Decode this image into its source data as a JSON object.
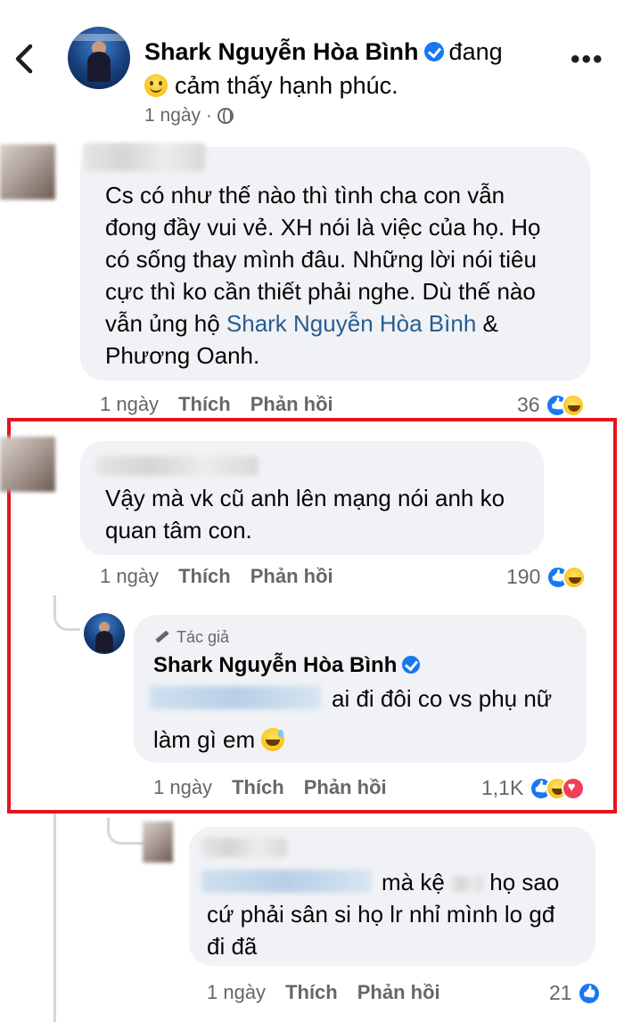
{
  "header": {
    "author_name": "Shark Nguyễn Hòa Bình",
    "status_word": "đang",
    "feeling": "cảm thấy hạnh phúc.",
    "post_time": "1 ngày ·",
    "more_label": "•••"
  },
  "comments": [
    {
      "text_lines": [
        "Cs có như thế nào thì tình cha con vẫn",
        "đong đầy vui vẻ. XH nói là việc của họ. Họ",
        "có sống thay mình đâu. Những lời nói tiêu",
        "cực thì ko cần thiết phải nghe. Dù thế nào"
      ],
      "line5_prefix": "vẫn ủng hộ ",
      "mention": "Shark Nguyễn Hòa Bình",
      "line5_suffix": "  &",
      "line6": "Phương Oanh.",
      "time": "1 ngày",
      "like_label": "Thích",
      "reply_label": "Phản hồi",
      "reaction_count": "36"
    },
    {
      "text_lines": [
        "Vậy mà vk cũ anh lên mạng nói anh ko",
        "quan tâm con."
      ],
      "time": "1 ngày",
      "like_label": "Thích",
      "reply_label": "Phản hồi",
      "reaction_count": "190"
    }
  ],
  "author_reply": {
    "badge": "Tác giả",
    "name": "Shark Nguyễn Hòa Bình",
    "line1": "ai đi đôi co vs phụ nữ",
    "line2": "làm gì em",
    "time": "1 ngày",
    "like_label": "Thích",
    "reply_label": "Phản hồi",
    "reaction_count": "1,1K"
  },
  "last_reply": {
    "line1": "mà kệ",
    "line1b": "họ sao",
    "line2": "cứ phải sân si họ lr nhỉ mình lo gđ",
    "line3": "đi đã",
    "time": "1 ngày",
    "like_label": "Thích",
    "reply_label": "Phản hồi",
    "reaction_count": "21"
  },
  "colors": {
    "accent": "#1877f2",
    "highlight_border": "#e4141c",
    "bubble": "#f0f2f5",
    "mention": "#2a5d8f"
  }
}
